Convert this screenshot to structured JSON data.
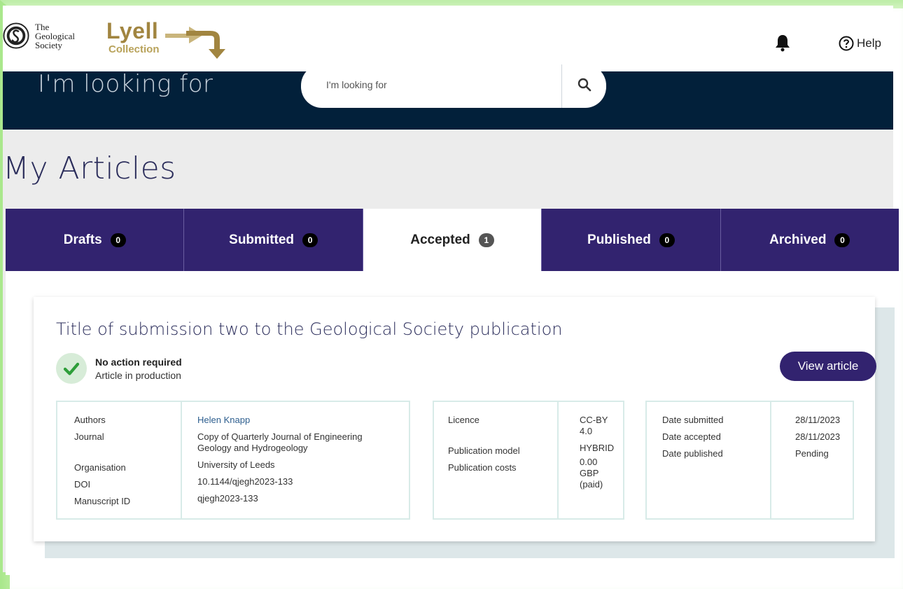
{
  "header": {
    "gs_logo": {
      "line1": "The",
      "line2": "Geological",
      "line3": "Society"
    },
    "lyell": {
      "word": "Lyell",
      "sub": "Collection"
    },
    "help_label": "Help",
    "icons": {
      "bell": "bell-icon",
      "help": "help-circle-icon",
      "search": "search-icon"
    }
  },
  "search": {
    "heading": "I'm looking for",
    "placeholder": "I'm looking for"
  },
  "page": {
    "title": "My Articles"
  },
  "tabs": [
    {
      "label": "Drafts",
      "count": "0"
    },
    {
      "label": "Submitted",
      "count": "0"
    },
    {
      "label": "Accepted",
      "count": "1"
    },
    {
      "label": "Published",
      "count": "0"
    },
    {
      "label": "Archived",
      "count": "0"
    }
  ],
  "active_tab": "Accepted",
  "article": {
    "title": "Title of submission two to the Geological Society publication",
    "status_title": "No action required",
    "status_sub": "Article in production",
    "view_label": "View article",
    "details": {
      "authors_label": "Authors",
      "authors": "Helen Knapp",
      "journal_label": "Journal",
      "journal_line1": "Copy of Quarterly Journal of Engineering",
      "journal_line2": "Geology and Hydrogeology",
      "organisation_label": "Organisation",
      "organisation": "University of Leeds",
      "doi_label": "DOI",
      "doi": "10.1144/qjegh2023-133",
      "manuscript_label": "Manuscript ID",
      "manuscript": "qjegh2023-133"
    },
    "licence": {
      "licence_label": "Licence",
      "licence_line1": "CC-BY",
      "licence_line2": "4.0",
      "model_label": "Publication model",
      "model": "HYBRID",
      "costs_label": "Publication costs",
      "costs_line1": "0.00",
      "costs_line2": "GBP",
      "costs_line3": "(paid)"
    },
    "dates": {
      "submitted_label": "Date submitted",
      "submitted": "28/11/2023",
      "accepted_label": "Date accepted",
      "accepted": "28/11/2023",
      "published_label": "Date published",
      "published": "Pending"
    }
  },
  "colors": {
    "navy": "#02203a",
    "purple": "#32236f",
    "gold": "#a18540",
    "heading": "#2b2d5b",
    "green_check": "#2e9e3a"
  }
}
